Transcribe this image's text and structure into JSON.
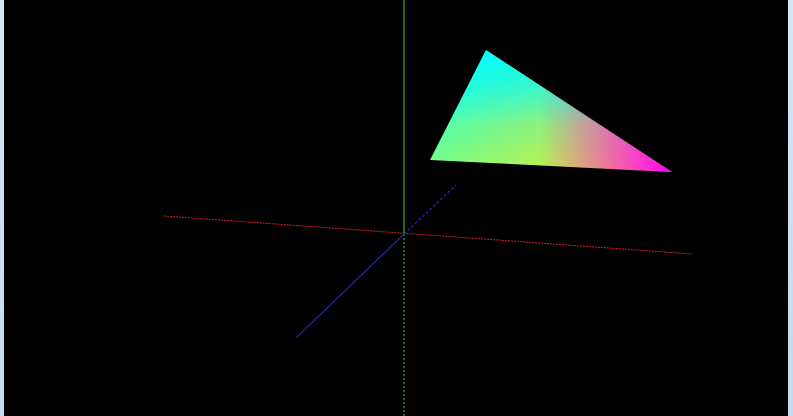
{
  "scene": {
    "background_color": "#000000",
    "window_frame_color": "#cfe0f0",
    "axes": {
      "x_axis_color": "#d81f1f",
      "y_axis_color": "#39d14b",
      "z_axis_color": "#2828b8"
    },
    "triangle": {
      "vertex_colors": [
        "#00ffff",
        "#ffff00",
        "#ff00ff"
      ]
    }
  }
}
